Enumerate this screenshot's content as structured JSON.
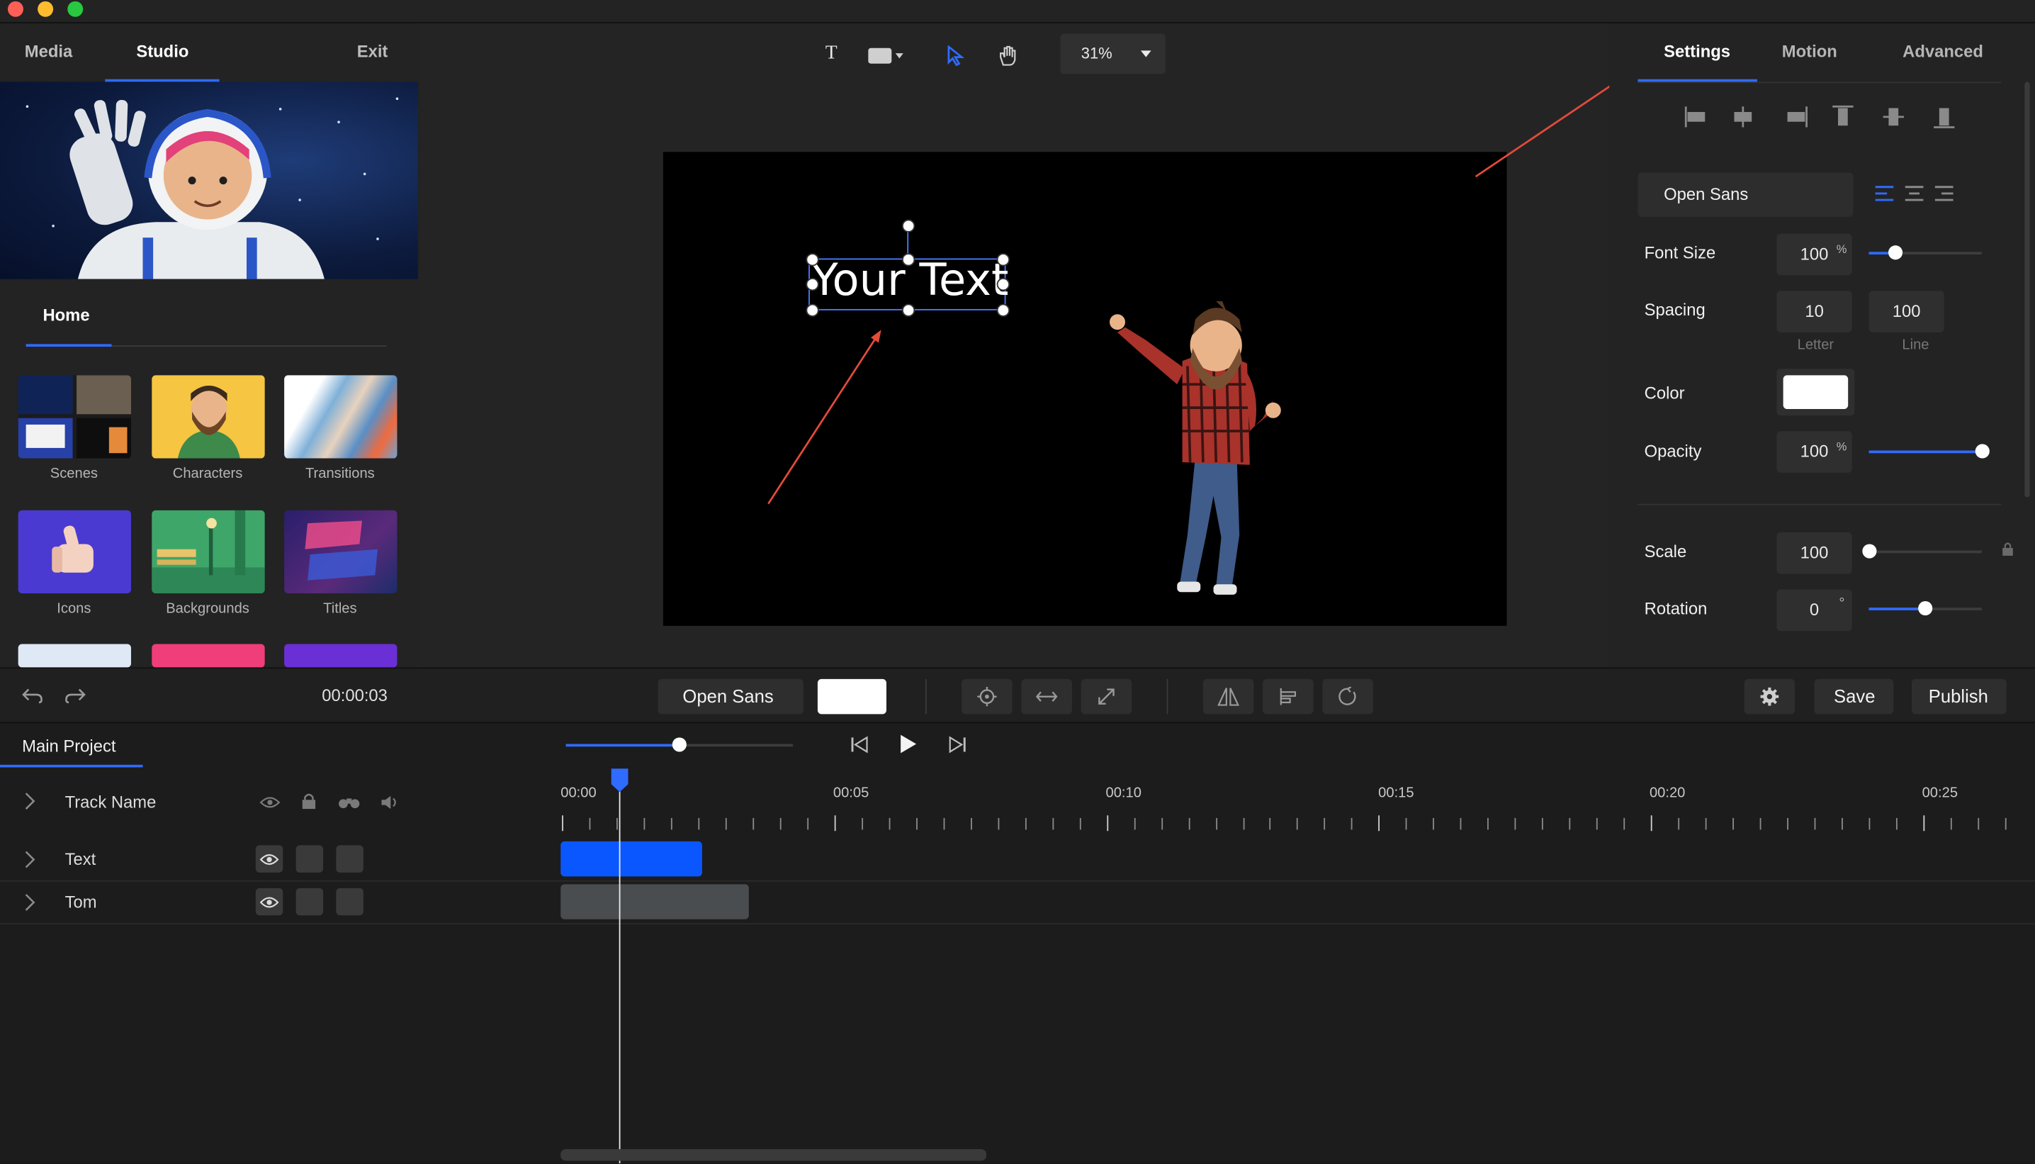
{
  "window": {
    "traffic_lights": [
      "#ff5f57",
      "#febc2e",
      "#28c840"
    ]
  },
  "left_panel": {
    "tabs": [
      "Media",
      "Studio",
      "Exit"
    ],
    "active_tab": "Studio",
    "section_tab": "Home",
    "categories": [
      {
        "label": "Scenes",
        "icon": "scenes-collage"
      },
      {
        "label": "Characters",
        "icon": "bearded-character"
      },
      {
        "label": "Transitions",
        "icon": "swirl-transition"
      },
      {
        "label": "Icons",
        "icon": "thumbs-up-hand"
      },
      {
        "label": "Backgrounds",
        "icon": "park-background"
      },
      {
        "label": "Titles",
        "icon": "typography-title"
      }
    ]
  },
  "toolbar": {
    "text_tool": "T",
    "zoom": "31%"
  },
  "canvas": {
    "text_layer": "Your Text",
    "character": "Tom"
  },
  "right_panel": {
    "tabs": [
      "Settings",
      "Motion",
      "Advanced"
    ],
    "active_tab": "Settings",
    "font": "Open Sans",
    "font_size": {
      "label": "Font Size",
      "value": "100",
      "unit": "%",
      "slider_fraction": 0.24
    },
    "spacing": {
      "label": "Spacing",
      "letter": "10",
      "line": "100",
      "letter_caption": "Letter",
      "line_caption": "Line"
    },
    "color": {
      "label": "Color",
      "value": "#ffffff"
    },
    "opacity": {
      "label": "Opacity",
      "value": "100",
      "unit": "%",
      "slider_fraction": 1.0
    },
    "scale": {
      "label": "Scale",
      "value": "100",
      "slider_fraction": 0.0
    },
    "rotation": {
      "label": "Rotation",
      "value": "0",
      "unit": "°",
      "slider_fraction": 0.5
    }
  },
  "control_bar": {
    "time": "00:00:03",
    "font": "Open Sans",
    "text_color": "#ffffff",
    "save_label": "Save",
    "publish_label": "Publish"
  },
  "timeline": {
    "project_tab": "Main Project",
    "header_track": "Track Name",
    "time_markers": [
      "00:00",
      "00:05",
      "00:10",
      "00:15",
      "00:20",
      "00:25"
    ],
    "volume_fraction": 0.5,
    "tracks": [
      {
        "name": "Text",
        "color": "#0a57ff"
      },
      {
        "name": "Tom",
        "color": "#4a4d4f"
      }
    ]
  },
  "accent_color": "#2f6bff"
}
